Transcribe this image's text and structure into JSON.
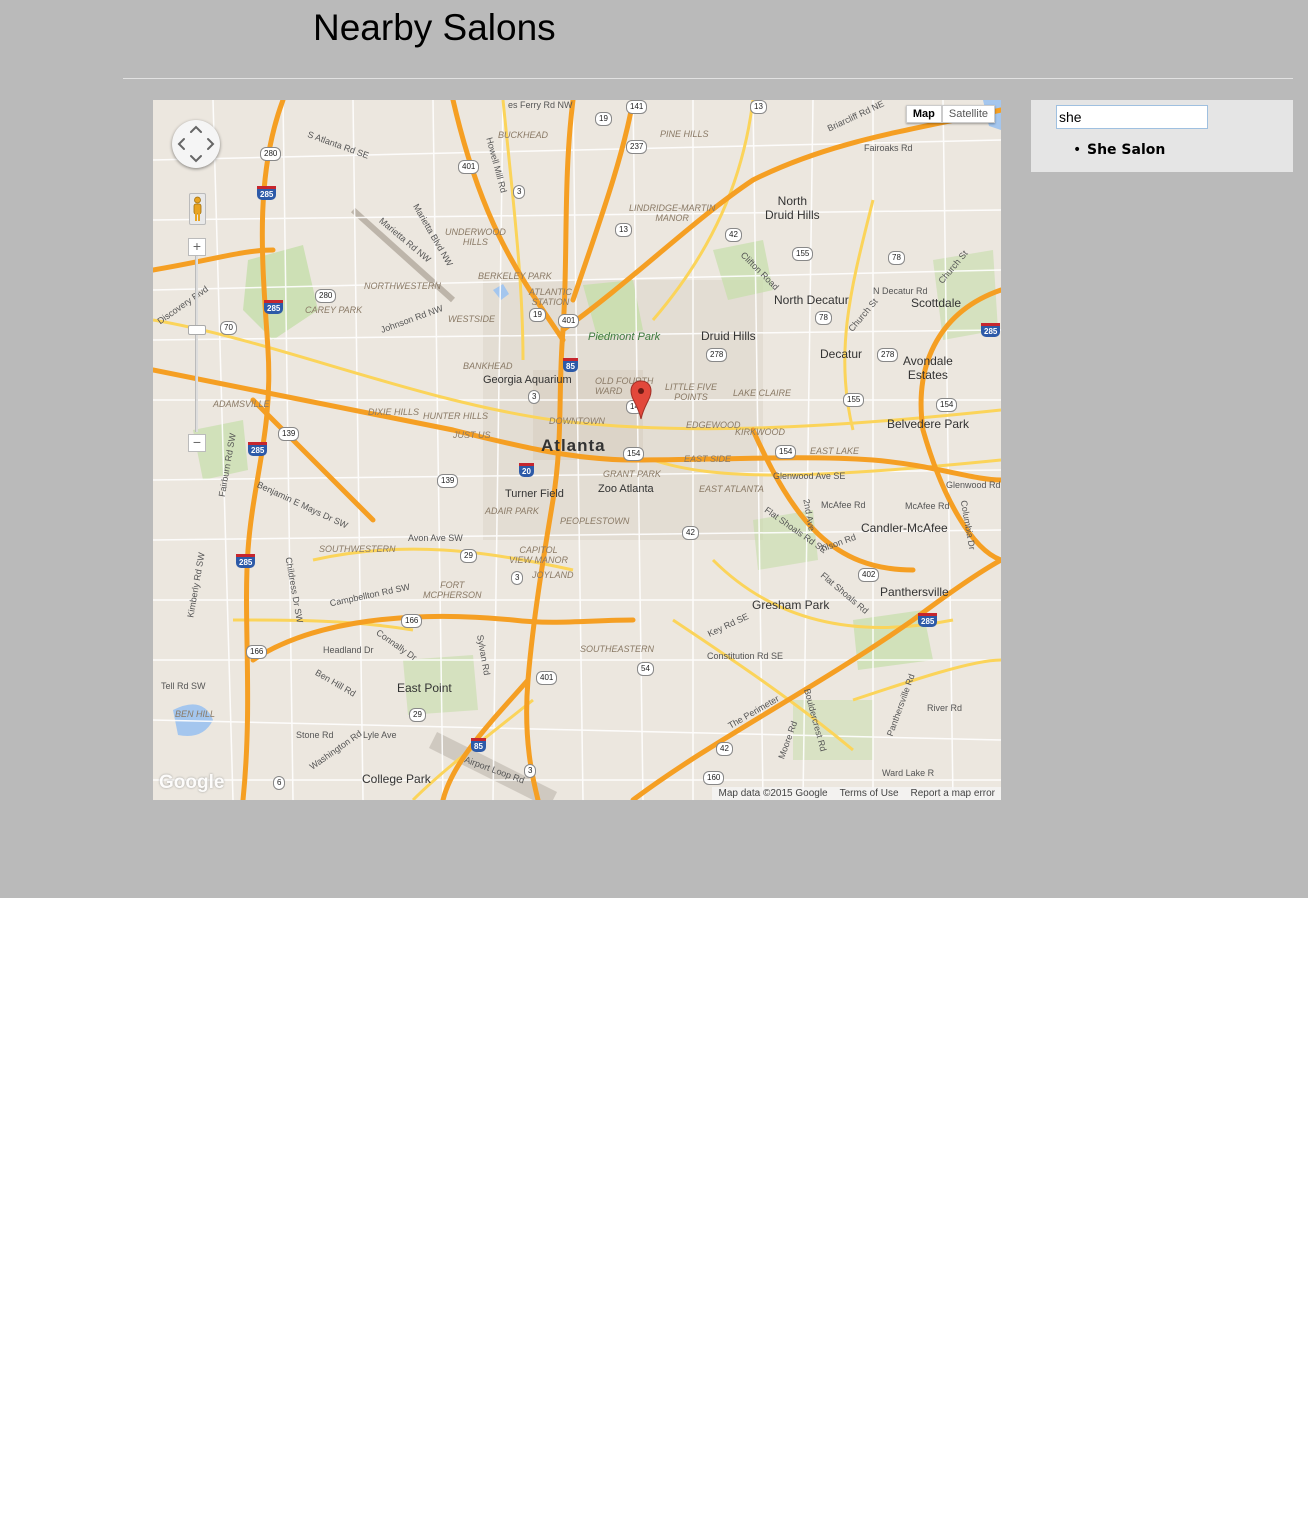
{
  "page": {
    "title": "Nearby Salons"
  },
  "map": {
    "type_controls": {
      "map": "Map",
      "satellite": "Satellite",
      "active": "Map"
    },
    "logo": "Google",
    "attribution": {
      "data": "Map data ©2015 Google",
      "terms": "Terms of Use",
      "report": "Report a map error"
    },
    "labels": {
      "atlanta": "Atlanta",
      "north_druid_hills": "North\nDruid Hills",
      "north_decatur": "North Decatur",
      "scottdale": "Scottdale",
      "druid_hills": "Druid Hills",
      "decatur": "Decatur",
      "avondale_estates": "Avondale\nEstates",
      "belvedere_park": "Belvedere Park",
      "candler_mcafee": "Candler-McAfee",
      "panthersville": "Panthersville",
      "gresham_park": "Gresham Park",
      "east_point": "East Point",
      "college_park": "College Park",
      "georgia_aquarium": "Georgia Aquarium",
      "turner_field": "Turner Field",
      "zoo_atlanta": "Zoo Atlanta",
      "piedmont_park": "Piedmont Park",
      "downtown": "DOWNTOWN",
      "buckhead": "BUCKHEAD",
      "pine_hills": "PINE HILLS",
      "lindridge": "LINDRIDGE-MARTIN\nMANOR",
      "underwood_hills": "UNDERWOOD\nHILLS",
      "berkeley_park": "BERKELEY PARK",
      "atlantic_station": "ATLANTIC\nSTATION",
      "northwestern": "NORTHWESTERN",
      "carey_park": "CAREY PARK",
      "westside": "WESTSIDE",
      "bankhead": "BANKHEAD",
      "old_fourth_ward": "OLD FOURTH\nWARD",
      "little_five_points": "LITTLE FIVE\nPOINTS",
      "lake_claire": "LAKE CLAIRE",
      "edgewood": "EDGEWOOD",
      "kirkwood": "KIRKWOOD",
      "east_lake": "EAST LAKE",
      "east_side": "EAST SIDE",
      "east_atlanta": "EAST ATLANTA",
      "grant_park": "GRANT PARK",
      "adair_park": "ADAIR PARK",
      "peoplestown": "PEOPLESTOWN",
      "capitol_view_manor": "CAPITOL\nVIEW MANOR",
      "joyland": "JOYLAND",
      "southwestern": "SOUTHWESTERN",
      "fort_mcpherson": "FORT\nMCPHERSON",
      "southeastern": "SOUTHEASTERN",
      "adamsville": "ADAMSVILLE",
      "dixie_hills": "DIXIE HILLS",
      "hunter_hills": "HUNTER HILLS",
      "just_us": "JUST US",
      "ben_hill": "BEN HILL",
      "r_glenwood": "Glenwood Ave SE",
      "r_glenwood_rd": "Glenwood Rd",
      "r_mcafee": "McAfee Rd",
      "r_mcafee2": "McAfee Rd",
      "r_tilson": "Tilson Rd",
      "r_flat_shoals": "Flat Shoals Rd SE",
      "r_flat_shoals2": "Flat Shoals Rd",
      "r_key": "Key Rd SE",
      "r_constitution": "Constitution Rd SE",
      "r_the_perimeter": "The Perimeter",
      "r_river": "River Rd",
      "r_ward_lake": "Ward Lake R",
      "r_fairoaks": "Fairoaks Rd",
      "r_briarcliff": "Briarcliff Rd NE",
      "r_clifton": "Clifton Road",
      "r_n_decatur": "N Decatur Rd",
      "r_church": "Church St",
      "r_church2": "Church St",
      "r_avon": "Avon Ave SW",
      "r_campbellton": "Campbellton Rd SW",
      "r_headland": "Headland Dr",
      "r_connally": "Connally Dr",
      "r_ben_hill": "Ben Hill Rd",
      "r_stone": "Stone Rd",
      "r_lyle": "Lyle Ave",
      "r_washington": "Washington Rd",
      "r_airport_loop": "Airport Loop Rd",
      "r_tell": "Tell Rd SW",
      "r_benjamin": "Benjamin E Mays Dr SW",
      "r_marietta": "Marietta Blvd NW",
      "r_marietta2": "Marietta Rd NW",
      "r_johnson": "Johnson Rd NW",
      "r_atlanta_rd": "S Atlanta Rd SE",
      "r_discovery": "Discovery Blvd",
      "r_howell": "Howell Mill Rd",
      "r_sylvan": "Sylvan Rd",
      "r_fairburn": "Fairburn Rd SW",
      "r_childress": "Childress Dr SW",
      "r_kimberly": "Kimberly Rd SW",
      "r_2nd": "2nd Ave",
      "r_moore": "Moore Rd",
      "r_bouldercrest": "Bouldercrest Rd",
      "r_panthersville": "Panthersville Rd",
      "r_columbia": "Columbia Dr",
      "r_ferry": "es Ferry Rd NW"
    },
    "shields": {
      "s141": "141",
      "s19a": "19",
      "s237": "237",
      "s13a": "13",
      "s280a": "280",
      "s401a": "401",
      "s3a": "3",
      "s13b": "13",
      "s42a": "42",
      "s155a": "155",
      "s78a": "78",
      "s280b": "280",
      "s19b": "19",
      "s401b": "401",
      "s70": "70",
      "s278a": "278",
      "s78b": "78",
      "s278b": "278",
      "s3b": "3",
      "s155b": "155",
      "s154a": "154",
      "s139a": "139",
      "s154b": "154",
      "s154c": "154",
      "s139b": "139",
      "s42b": "42",
      "s29a": "29",
      "s3c": "3",
      "s166a": "166",
      "s402": "402",
      "s54": "54",
      "s401c": "401",
      "s166b": "166",
      "s29b": "29",
      "s3d": "3",
      "s42c": "42",
      "s160": "160",
      "s6": "6",
      "s14": "14",
      "i285a": "285",
      "i285b": "285",
      "i285c": "285",
      "i285d": "285",
      "i285e": "285",
      "i285f": "285",
      "i85": "85",
      "i20": "20",
      "i85b": "85"
    }
  },
  "sidebar": {
    "search_value": "she",
    "results": [
      "She Salon"
    ]
  },
  "colors": {
    "page_bg": "#bababa",
    "sidebar_bg": "#e5e5e5",
    "map_land": "#ece7df",
    "freeway": "#f59f23",
    "water": "#a4c6ee",
    "park": "#c6deaa",
    "marker": "#e2483b"
  }
}
